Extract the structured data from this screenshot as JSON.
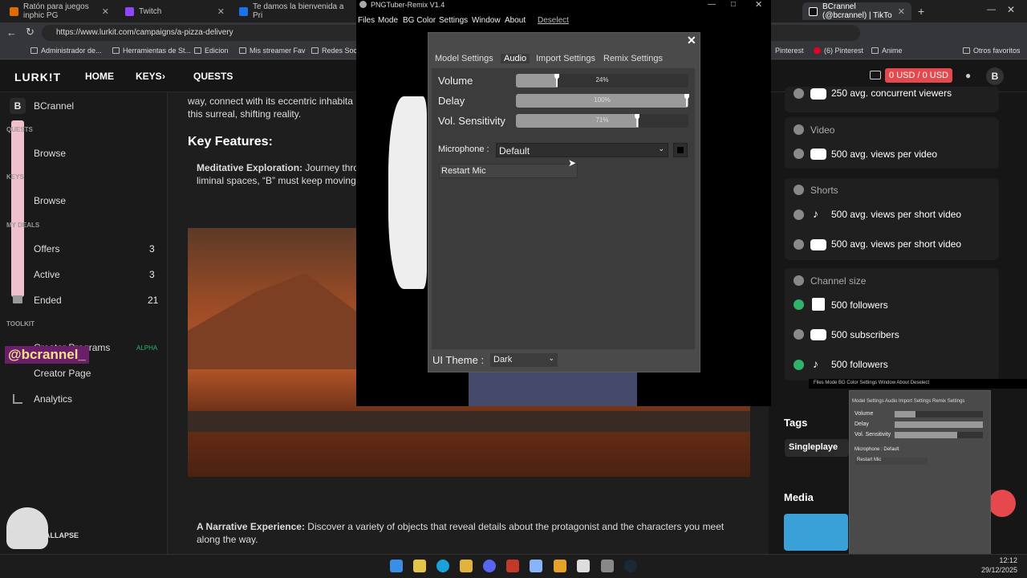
{
  "browser": {
    "tabs": [
      {
        "label": "Ratón para juegos inphic PG",
        "color": "#e06c00"
      },
      {
        "label": "Twitch",
        "color": "#9146ff"
      },
      {
        "label": "Te damos la bienvenida a Pri",
        "color": "#1a73e8"
      },
      {
        "label": "BCrannel (@bcrannel) | TikTo",
        "color": "#111111"
      }
    ],
    "url": "https://www.lurkit.com/campaigns/a-pizza-delivery",
    "bookmarks": [
      "Administrador de...",
      "Herramientas de St...",
      "Edicion",
      "Mis streamer Fav",
      "Redes Socia",
      "Pinterest",
      "(6) Pinterest",
      "Anime",
      "Otros favoritos"
    ]
  },
  "site": {
    "logo": "LURK!T",
    "nav": [
      "HOME",
      "KEYS",
      "QUESTS"
    ],
    "balance": "0 USD / 0 USD",
    "avatar_letter": "B",
    "sidebar": {
      "user_initial": "B",
      "user_name": "BCrannel",
      "sections": [
        "QUESTS",
        "KEYS",
        "MY DEALS",
        "TOOLKIT"
      ],
      "items": [
        {
          "label": "Browse"
        },
        {
          "label": "Browse"
        },
        {
          "label": "Offers",
          "count": "3"
        },
        {
          "label": "Active",
          "count": "3"
        },
        {
          "label": "Ended",
          "count": "21"
        },
        {
          "label": "Creator Programs",
          "badge": "ALPHA"
        },
        {
          "label": "Creator Page"
        },
        {
          "label": "Analytics"
        }
      ],
      "overlay_name": "@bcrannel_",
      "collapse": "ALLAPSE"
    },
    "content": {
      "intro": "way, connect with its eccentric inhabita",
      "intro2": "this surreal, shifting reality.",
      "heading": "Key Features:",
      "feature1_bold": "Meditative Exploration:",
      "feature1": " Journey thro",
      "feature1_line2": "liminal spaces, “B” must keep moving",
      "feature2_bold": "A Narrative Experience:",
      "feature2": " Discover a variety of objects that reveal details about the protagonist and the characters you meet",
      "feature2_line2": "along the way."
    },
    "right": {
      "items": [
        {
          "text": "250 avg. concurrent viewers",
          "status": "x",
          "platform": "youtube"
        },
        {
          "text": "500 avg. views per video",
          "status": "x",
          "platform": "youtube"
        },
        {
          "text": "500 avg. views per short video",
          "status": "x",
          "platform": "tiktok"
        },
        {
          "text": "500 avg. views per short video",
          "status": "x",
          "platform": "youtube"
        },
        {
          "text": "500 followers",
          "status": "ok",
          "platform": "twitch"
        },
        {
          "text": "500 subscribers",
          "status": "x",
          "platform": "youtube"
        },
        {
          "text": "500 followers",
          "status": "ok",
          "platform": "tiktok"
        }
      ],
      "headers": [
        "Video",
        "Shorts",
        "Channel size"
      ],
      "tags_title": "Tags",
      "tag1": "Singleplaye",
      "media_title": "Media"
    }
  },
  "app": {
    "title": "PNGTuber-Remix V1.4",
    "menu": [
      "Files",
      "Mode",
      "BG Color",
      "Settings",
      "Window",
      "About",
      "Deselect"
    ],
    "tabs": [
      "Model Settings",
      "Audio",
      "Import Settings",
      "Remix Settings"
    ],
    "active_tab": "Audio",
    "sliders": [
      {
        "label": "Volume",
        "value": 0.24,
        "text": "24%"
      },
      {
        "label": "Delay",
        "value": 1.0,
        "text": "100%"
      },
      {
        "label": "Vol. Sensitivity",
        "value": 0.71,
        "text": "71%"
      }
    ],
    "microphone_label": "Microphone :",
    "microphone_value": "Default",
    "restart_label": "Restart Mic",
    "theme_label": "UI Theme :",
    "theme_value": "Dark",
    "close": "✕"
  },
  "taskbar": {
    "time": "12:12",
    "date": "29/12/2025"
  },
  "colors": {
    "accent": "#e5484d",
    "ok": "#2fb36b"
  }
}
